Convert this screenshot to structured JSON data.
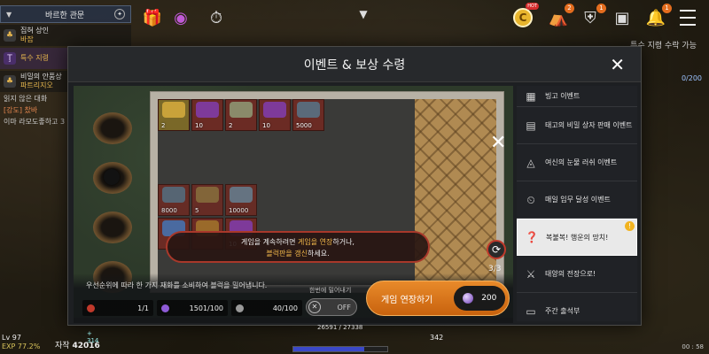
{
  "quest_panel": {
    "header": "바르한 관문",
    "items": [
      {
        "line1": "집혀 상인",
        "line2": "바잡",
        "icon": "bag-icon"
      },
      {
        "line1": "특수 지령",
        "line2": "",
        "icon": "scroll-icon"
      },
      {
        "line1": "비밀의 안품상",
        "line2": "파트리지오",
        "icon": "bag-icon"
      }
    ],
    "chat": [
      "읽지 않은 대화",
      "[강도] 찼바",
      "이마 라모도좋하고 3"
    ]
  },
  "top_bar": {
    "hot_badge": "HOT",
    "badges": [
      "2",
      "1",
      "1"
    ],
    "right_label": "특수 지령 수락 가능",
    "right_count": "0/200"
  },
  "modal": {
    "title": "이벤트 & 보상 수령",
    "popup_text_1a": "게임을 계속하려면 ",
    "popup_text_1b": "게임을 연장",
    "popup_text_1c": "하거나,",
    "popup_text_2a": "블럭판을 갱신",
    "popup_text_2b": "하세요.",
    "refresh_count": "3/3",
    "hint": "우선순위에 따라 한 가지 재화를 소비하여 블럭을 밀어냅니다.",
    "resources": [
      {
        "value": "1/1",
        "color": "#c0392b"
      },
      {
        "value": "1501/100",
        "color": "#8e5bd6"
      },
      {
        "value": "40/100",
        "color": "#9a9a9a"
      }
    ],
    "auto_label": "한번에 밀어내기",
    "toggle_label": "OFF",
    "continue_label": "게임 연장하기",
    "continue_cost": "200"
  },
  "tiles": [
    {
      "num": "2",
      "color": "#c9a23a"
    },
    {
      "num": "10",
      "color": "#7e3a9a"
    },
    {
      "num": "2",
      "color": "#8a8a6a"
    },
    {
      "num": "10",
      "color": "#7e3a9a"
    },
    {
      "num": "5000",
      "color": "#5a6a7a"
    }
  ],
  "tiles_row2": [
    {
      "num": "8000",
      "color": "#5a6a7a"
    },
    {
      "num": "5",
      "color": "#8a6a3a"
    },
    {
      "num": "10000",
      "color": "#6a7a8a"
    }
  ],
  "tiles_row3": [
    {
      "num": "",
      "color": "#4a6aa0"
    },
    {
      "num": "",
      "color": "#9a6a2a"
    },
    {
      "num": "10",
      "color": "#7e3a9a"
    }
  ],
  "events": [
    {
      "label": "빙고 이벤트",
      "icon": "grid-icon"
    },
    {
      "label": "태고의 비밀 상자 판매 이벤트",
      "icon": "chest-icon"
    },
    {
      "label": "여신의 눈물 러쉬 이벤트",
      "icon": "drop-icon"
    },
    {
      "label": "매일 임무 달성 이벤트",
      "icon": "timer-icon"
    },
    {
      "label": "복불복! 행운의 망치!",
      "icon": "question-icon",
      "active": true
    },
    {
      "label": "태양의 전장으로!",
      "icon": "swords-icon"
    },
    {
      "label": "주간 출석부",
      "icon": "calendar-icon"
    }
  ],
  "hud": {
    "level": "Lv 97",
    "exp": "EXP 77.2%",
    "money_label": "자작",
    "money_plus": "+ 314",
    "money": "42016",
    "hp": "26591 / 27338",
    "value_342": "342",
    "time": "00 : 58"
  }
}
